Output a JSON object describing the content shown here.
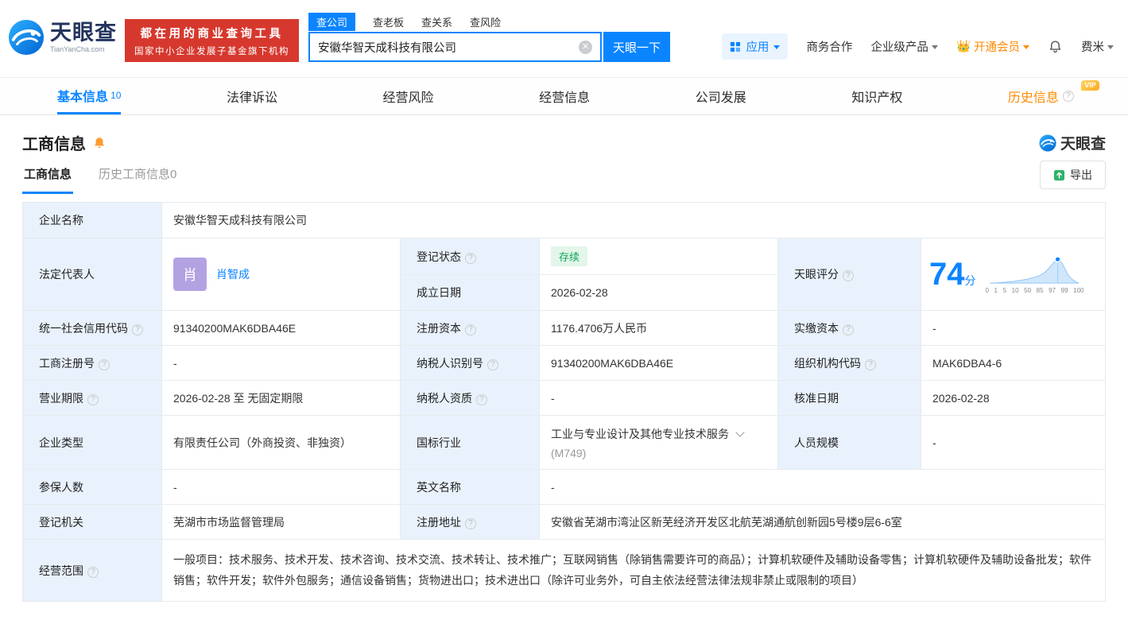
{
  "brand": {
    "logo_text": "天眼查",
    "logo_domain": "TianYanCha.com",
    "slogan_line1": "都在用的商业查询工具",
    "slogan_line2": "国家中小企业发展子基金旗下机构"
  },
  "search": {
    "tabs": [
      {
        "label": "查公司",
        "active": true
      },
      {
        "label": "查老板",
        "active": false
      },
      {
        "label": "查关系",
        "active": false
      },
      {
        "label": "查风险",
        "active": false
      }
    ],
    "value": "安徽华智天成科技有限公司",
    "button": "天眼一下"
  },
  "top_nav": {
    "app": "应用",
    "cooperation": "商务合作",
    "enterprise": "企业级产品",
    "vip": "开通会员",
    "user": "费米"
  },
  "main_tabs": [
    {
      "label": "基本信息",
      "count": "10",
      "active": true
    },
    {
      "label": "法律诉讼"
    },
    {
      "label": "经营风险"
    },
    {
      "label": "经营信息"
    },
    {
      "label": "公司发展"
    },
    {
      "label": "知识产权"
    },
    {
      "label": "历史信息",
      "badge": "VIP"
    }
  ],
  "section": {
    "title": "工商信息",
    "watermark": "天眼查",
    "subtab_active": "工商信息",
    "subtab_history": "历史工商信息0",
    "export": "导出"
  },
  "company": {
    "name_label": "企业名称",
    "name": "安徽华智天成科技有限公司",
    "legal_rep_label": "法定代表人",
    "legal_rep_avatar": "肖",
    "legal_rep": "肖智成",
    "reg_status_label": "登记状态",
    "reg_status": "存续",
    "establish_label": "成立日期",
    "establish_date": "2026-02-28",
    "score_label": "天眼评分",
    "score": "74",
    "score_unit": "分",
    "uscc_label": "统一社会信用代码",
    "uscc": "91340200MAK6DBA46E",
    "reg_capital_label": "注册资本",
    "reg_capital": "1176.4706万人民币",
    "paid_capital_label": "实缴资本",
    "paid_capital": "-",
    "reg_number_label": "工商注册号",
    "reg_number": "-",
    "taxpayer_id_label": "纳税人识别号",
    "taxpayer_id": "91340200MAK6DBA46E",
    "org_code_label": "组织机构代码",
    "org_code": "MAK6DBA4-6",
    "term_label": "营业期限",
    "term": "2026-02-28 至 无固定期限",
    "taxpayer_quali_label": "纳税人资质",
    "taxpayer_quali": "-",
    "approve_date_label": "核准日期",
    "approve_date": "2026-02-28",
    "type_label": "企业类型",
    "type": "有限责任公司（外商投资、非独资）",
    "industry_label": "国标行业",
    "industry": "工业与专业设计及其他专业技术服务",
    "industry_code": "(M749)",
    "staff_label": "人员规模",
    "staff": "-",
    "insured_label": "参保人数",
    "insured": "-",
    "en_name_label": "英文名称",
    "en_name": "-",
    "authority_label": "登记机关",
    "authority": "芜湖市市场监督管理局",
    "address_label": "注册地址",
    "address": "安徽省芜湖市湾沚区新芜经济开发区北航芜湖通航创新园5号楼9层6-6室",
    "scope_label": "经营范围",
    "scope": "一般项目：技术服务、技术开发、技术咨询、技术交流、技术转让、技术推广；互联网销售（除销售需要许可的商品）；计算机软硬件及辅助设备零售；计算机软硬件及辅助设备批发；软件销售；软件开发；软件外包服务；通信设备销售；货物进出口；技术进出口（除许可业务外，可自主依法经营法律法规非禁止或限制的项目）"
  },
  "score_chart": {
    "type": "area",
    "score": 74,
    "x_labels": [
      "0",
      "1",
      "5",
      "10",
      "50",
      "85",
      "97",
      "99",
      "100"
    ]
  },
  "colors": {
    "accent_blue": "#0a84ff",
    "brand_red": "#d6382e",
    "vip_orange": "#ff8a00",
    "status_green": "#10a35c",
    "label_bg": "#e9f2fc"
  }
}
